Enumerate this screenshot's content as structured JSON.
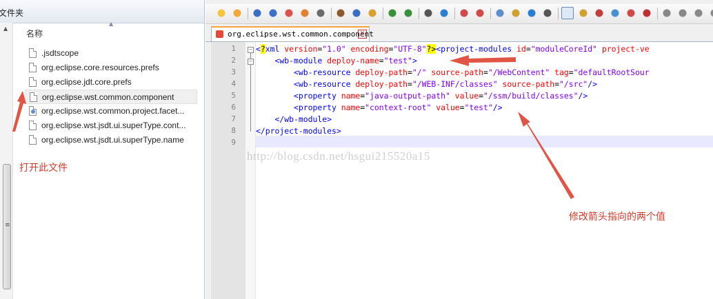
{
  "explorer": {
    "header_title": "文件夹",
    "column_name": "名称",
    "files": [
      {
        "name": ".jsdtscope",
        "icon": "file-icon"
      },
      {
        "name": "org.eclipse.core.resources.prefs",
        "icon": "file-icon"
      },
      {
        "name": "org.eclipse.jdt.core.prefs",
        "icon": "file-icon"
      },
      {
        "name": "org.eclipse.wst.common.component",
        "icon": "file-icon",
        "selected": true
      },
      {
        "name": "org.eclipse.wst.common.project.facet...",
        "icon": "facet-file-icon"
      },
      {
        "name": "org.eclipse.wst.jsdt.ui.superType.cont...",
        "icon": "file-icon"
      },
      {
        "name": "org.eclipse.wst.jsdt.ui.superType.name",
        "icon": "file-icon"
      }
    ]
  },
  "editor": {
    "tab_label": "org.eclipse.wst.common.component",
    "line_numbers": [
      "1",
      "2",
      "3",
      "4",
      "5",
      "6",
      "7",
      "8",
      "9"
    ],
    "lines": [
      {
        "indent": "",
        "tokens": [
          {
            "t": "<",
            "c": "t-tag"
          },
          {
            "t": "?",
            "c": "t-pi"
          },
          {
            "t": "xml ",
            "c": "t-tag"
          },
          {
            "t": "version",
            "c": "t-attr"
          },
          {
            "t": "=",
            "c": "t-eq"
          },
          {
            "t": "\"1.0\"",
            "c": "t-val"
          },
          {
            "t": " ",
            "c": "t-eq"
          },
          {
            "t": "encoding",
            "c": "t-attr"
          },
          {
            "t": "=",
            "c": "t-eq"
          },
          {
            "t": "\"UTF-8\"",
            "c": "t-val"
          },
          {
            "t": "?>",
            "c": "t-pi"
          },
          {
            "t": "<project-modules ",
            "c": "t-tag"
          },
          {
            "t": "id",
            "c": "t-attr"
          },
          {
            "t": "=",
            "c": "t-eq"
          },
          {
            "t": "\"moduleCoreId\"",
            "c": "t-val"
          },
          {
            "t": " ",
            "c": "t-eq"
          },
          {
            "t": "project-ve",
            "c": "t-attr"
          }
        ]
      },
      {
        "indent": "    ",
        "tokens": [
          {
            "t": "<wb-module ",
            "c": "t-tag"
          },
          {
            "t": "deploy-name",
            "c": "t-attr"
          },
          {
            "t": "=",
            "c": "t-eq"
          },
          {
            "t": "\"test\"",
            "c": "t-val"
          },
          {
            "t": ">",
            "c": "t-tag"
          }
        ]
      },
      {
        "indent": "        ",
        "tokens": [
          {
            "t": "<wb-resource ",
            "c": "t-tag"
          },
          {
            "t": "deploy-path",
            "c": "t-attr"
          },
          {
            "t": "=",
            "c": "t-eq"
          },
          {
            "t": "\"/\"",
            "c": "t-val"
          },
          {
            "t": " ",
            "c": "t-eq"
          },
          {
            "t": "source-path",
            "c": "t-attr"
          },
          {
            "t": "=",
            "c": "t-eq"
          },
          {
            "t": "\"/WebContent\"",
            "c": "t-val"
          },
          {
            "t": " ",
            "c": "t-eq"
          },
          {
            "t": "tag",
            "c": "t-attr"
          },
          {
            "t": "=",
            "c": "t-eq"
          },
          {
            "t": "\"defaultRootSour",
            "c": "t-val"
          }
        ]
      },
      {
        "indent": "        ",
        "tokens": [
          {
            "t": "<wb-resource ",
            "c": "t-tag"
          },
          {
            "t": "deploy-path",
            "c": "t-attr"
          },
          {
            "t": "=",
            "c": "t-eq"
          },
          {
            "t": "\"/WEB-INF/classes\"",
            "c": "t-val"
          },
          {
            "t": " ",
            "c": "t-eq"
          },
          {
            "t": "source-path",
            "c": "t-attr"
          },
          {
            "t": "=",
            "c": "t-eq"
          },
          {
            "t": "\"/src\"",
            "c": "t-val"
          },
          {
            "t": "/>",
            "c": "t-tag"
          }
        ]
      },
      {
        "indent": "        ",
        "tokens": [
          {
            "t": "<property ",
            "c": "t-tag"
          },
          {
            "t": "name",
            "c": "t-attr"
          },
          {
            "t": "=",
            "c": "t-eq"
          },
          {
            "t": "\"java-output-path\"",
            "c": "t-val"
          },
          {
            "t": " ",
            "c": "t-eq"
          },
          {
            "t": "value",
            "c": "t-attr"
          },
          {
            "t": "=",
            "c": "t-eq"
          },
          {
            "t": "\"/ssm/build/classes\"",
            "c": "t-val"
          },
          {
            "t": "/>",
            "c": "t-tag"
          }
        ]
      },
      {
        "indent": "        ",
        "tokens": [
          {
            "t": "<property ",
            "c": "t-tag"
          },
          {
            "t": "name",
            "c": "t-attr"
          },
          {
            "t": "=",
            "c": "t-eq"
          },
          {
            "t": "\"context-root\"",
            "c": "t-val"
          },
          {
            "t": " ",
            "c": "t-eq"
          },
          {
            "t": "value",
            "c": "t-attr"
          },
          {
            "t": "=",
            "c": "t-eq"
          },
          {
            "t": "\"test\"",
            "c": "t-val"
          },
          {
            "t": "/>",
            "c": "t-tag"
          }
        ]
      },
      {
        "indent": "    ",
        "tokens": [
          {
            "t": "</wb-module>",
            "c": "t-tag"
          }
        ]
      },
      {
        "indent": "",
        "tokens": [
          {
            "t": "</project-modules>",
            "c": "t-tag"
          }
        ]
      },
      {
        "indent": "",
        "tokens": []
      }
    ]
  },
  "annotations": {
    "open_file": "打开此文件",
    "modify_values": "修改箭头指向的两个值"
  },
  "watermark": "http://blog.csdn.net/hsgui215520a15",
  "colors": {
    "annotation_red": "#d23b2c",
    "xml_tag": "#0000ff",
    "xml_attr": "#ff0000",
    "xml_value": "#8000ff",
    "tab_accent": "#f6a43b"
  }
}
